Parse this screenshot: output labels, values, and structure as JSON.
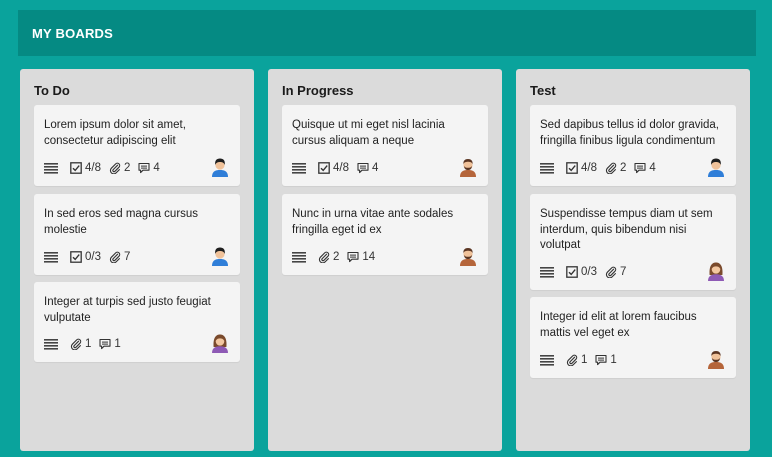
{
  "header": {
    "title": "MY BOARDS"
  },
  "columns": [
    {
      "title": "To Do",
      "cards": [
        {
          "text": "Lorem ipsum dolor sit amet, consectetur adipiscing elit",
          "checklist": "4/8",
          "attachments": "2",
          "comments": "4",
          "avatar": "man-dark-hair"
        },
        {
          "text": "In sed eros sed magna cursus molestie",
          "checklist": "0/3",
          "attachments": "7",
          "avatar": "man-dark-hair"
        },
        {
          "text": "Integer at turpis sed justo feugiat vulputate",
          "attachments": "1",
          "comments": "1",
          "avatar": "woman"
        }
      ]
    },
    {
      "title": "In Progress",
      "cards": [
        {
          "text": "Quisque ut mi eget nisl lacinia cursus aliquam a neque",
          "checklist": "4/8",
          "comments": "4",
          "avatar": "man-beard"
        },
        {
          "text": "Nunc in urna vitae ante sodales fringilla eget id ex",
          "attachments": "2",
          "comments": "14",
          "avatar": "man-beard"
        }
      ]
    },
    {
      "title": "Test",
      "cards": [
        {
          "text": "Sed dapibus tellus id dolor gravida, fringilla finibus ligula condimentum",
          "checklist": "4/8",
          "attachments": "2",
          "comments": "4",
          "avatar": "man-dark-hair"
        },
        {
          "text": "Suspendisse tempus diam ut sem interdum, quis bibendum nisi volutpat",
          "checklist": "0/3",
          "attachments": "7",
          "avatar": "woman"
        },
        {
          "text": "Integer id elit at lorem faucibus mattis vel eget ex",
          "attachments": "1",
          "comments": "1",
          "avatar": "man-beard"
        }
      ]
    }
  ],
  "colors": {
    "background": "#0aa39c",
    "header": "#058a83",
    "column": "#dbdbdb",
    "card": "#f4f4f4"
  }
}
